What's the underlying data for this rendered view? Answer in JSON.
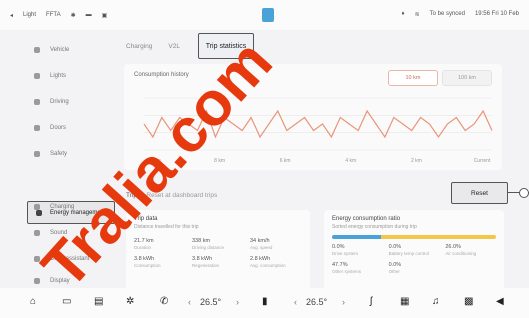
{
  "status_bar": {
    "items": [
      "Light",
      "FFTA",
      "",
      "",
      ""
    ],
    "right_items": [
      "",
      "",
      "To be synced",
      "19:56 Fri 10 Feb"
    ]
  },
  "sidebar": {
    "items": [
      {
        "label": "Vehicle"
      },
      {
        "label": "Lights"
      },
      {
        "label": "Driving"
      },
      {
        "label": "Doors"
      },
      {
        "label": "Safety"
      },
      {
        "label": "Energy management"
      },
      {
        "label": "Charging"
      },
      {
        "label": "Sound"
      },
      {
        "label": "Drive assistant"
      },
      {
        "label": "Display"
      }
    ],
    "active_label": "Energy management"
  },
  "tabs": {
    "items": [
      "Charging",
      "V2L"
    ],
    "active": "Trip statistics"
  },
  "consumption_chart": {
    "title": "Consumption history",
    "ranges": [
      "10 km",
      "100 km"
    ],
    "x_labels": [
      "10 km",
      "8 km",
      "6 km",
      "4 km",
      "2 km",
      "Current"
    ]
  },
  "chart_data": {
    "type": "line",
    "title": "Consumption history",
    "x": [
      "10 km",
      "8 km",
      "6 km",
      "4 km",
      "2 km",
      "Current"
    ],
    "series": [
      {
        "values": [
          14,
          12,
          15,
          13,
          15,
          14,
          13,
          16,
          12,
          15,
          14,
          13,
          15,
          12,
          14,
          16,
          13,
          14,
          15,
          13,
          14,
          12,
          15,
          14,
          13,
          16,
          14,
          12,
          15,
          14,
          13,
          15,
          14,
          12,
          14,
          15,
          13,
          14,
          16,
          13
        ]
      }
    ],
    "grid": true,
    "colors": [
      "#e8957a"
    ]
  },
  "trip": {
    "header": "Trip 1",
    "subheader": "Reset at dashboard trips",
    "reset_label": "Reset"
  },
  "trip_card": {
    "title": "Trip data",
    "subtitle": "Distance travelled for this trip",
    "stats": [
      {
        "value": "21.7 km",
        "label": "Duration"
      },
      {
        "value": "338 km",
        "label": "Driving distance"
      },
      {
        "value": "34 km/h",
        "label": "Avg. speed"
      },
      {
        "value": "3.8 kWh",
        "label": "Consumption"
      },
      {
        "value": "3.8 kWh",
        "label": "Regeneration"
      },
      {
        "value": "2.8 kWh",
        "label": "Avg. consumption"
      }
    ]
  },
  "energy_card": {
    "title": "Energy consumption ratio",
    "subtitle": "Sorted energy consumption during trip",
    "stats": [
      {
        "value": "0.0%",
        "label": "Drive system"
      },
      {
        "value": "0.0%",
        "label": "Battery temp control"
      },
      {
        "value": "26.0%",
        "label": "Air conditioning"
      },
      {
        "value": "47.7%",
        "label": "Other systems"
      },
      {
        "value": "0.0%",
        "label": "Other"
      }
    ]
  },
  "dock": {
    "temp_left": "26.5°",
    "temp_right": "26.5°"
  },
  "watermark": {
    "text": "Tralia.com"
  }
}
